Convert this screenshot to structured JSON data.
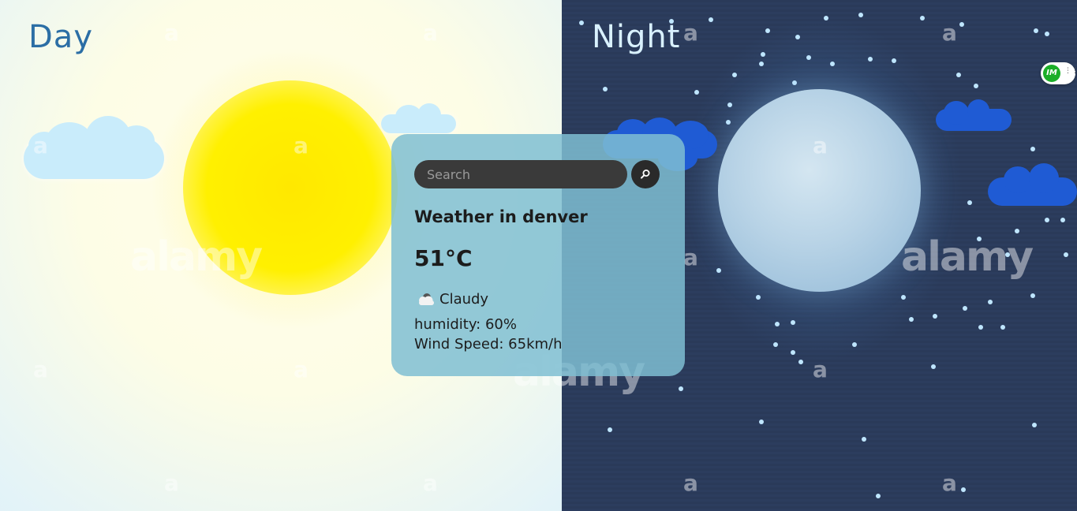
{
  "scene": {
    "day_label": "Day",
    "night_label": "Night",
    "watermarks": [
      "a",
      "alamy"
    ]
  },
  "widget": {
    "initials": "IM",
    "menu_glyph": "⋮⋮"
  },
  "weather": {
    "search_placeholder": "Search",
    "search_value": "",
    "search_button_icon": "search-icon",
    "city_line": "Weather in denver",
    "temperature": "51°C",
    "condition_icon": "cloud-icon",
    "condition": "Claudy",
    "humidity": "humidity: 60%",
    "wind": "Wind Speed: 65km/h"
  },
  "colors": {
    "card_bg": "#7fbed2",
    "search_bg": "#3a3a3a",
    "day_text": "#2b6ea5",
    "night_text": "#d9f1ff",
    "cloud_day": "#c9ecfb",
    "cloud_night": "#1f5bd4",
    "badge_green": "#1bae28"
  }
}
